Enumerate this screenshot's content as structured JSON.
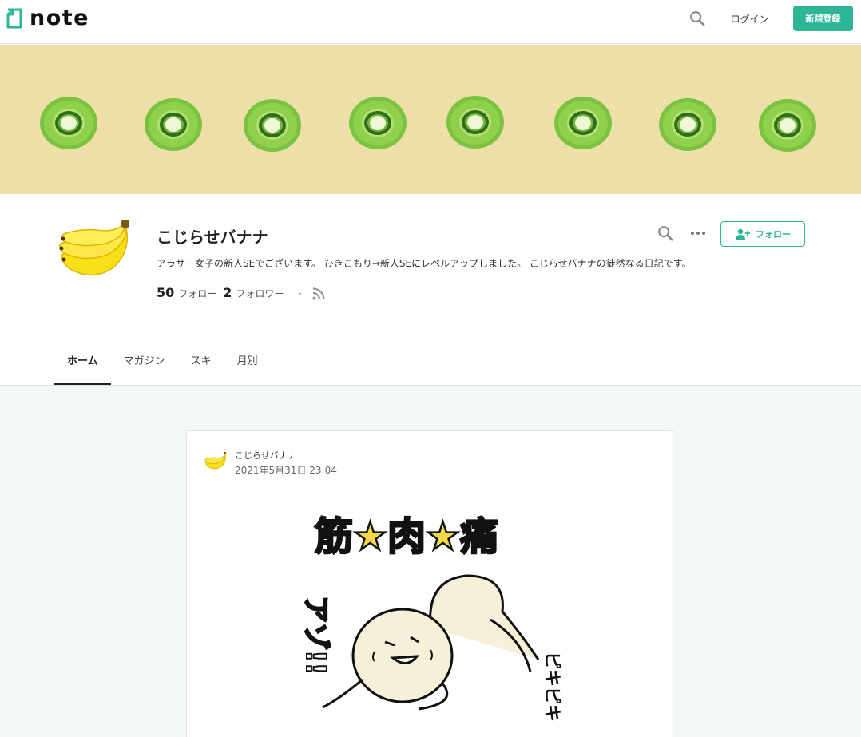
{
  "header": {
    "logo_text": "note",
    "login_label": "ログイン",
    "signup_label": "新規登録",
    "accent_color": "#2cb696"
  },
  "banner": {
    "background_color": "#ece0a8",
    "pattern": "kiwi-slices"
  },
  "profile": {
    "name": "こじらせバナナ",
    "description": "アラサー女子の新人SEでございます。 ひきこもり→新人SEにレベルアップしました。 こじらせバナナの徒然なる日記です。",
    "following_count": "50",
    "following_label": "フォロー",
    "follower_count": "2",
    "follower_label": "フォロワー",
    "separator": "・",
    "follow_button_label": "フォロー",
    "avatar_icon": "banana-icon"
  },
  "tabs": [
    {
      "label": "ホーム",
      "active": true
    },
    {
      "label": "マガジン",
      "active": false
    },
    {
      "label": "スキ",
      "active": false
    },
    {
      "label": "月別",
      "active": false
    }
  ],
  "post": {
    "author": "こじらせバナナ",
    "date": "2021年5月31日 23:04",
    "image_text_title": "筋★肉★痛",
    "image_text_left": "アゾ!!",
    "image_text_right": "ピキピキ"
  }
}
